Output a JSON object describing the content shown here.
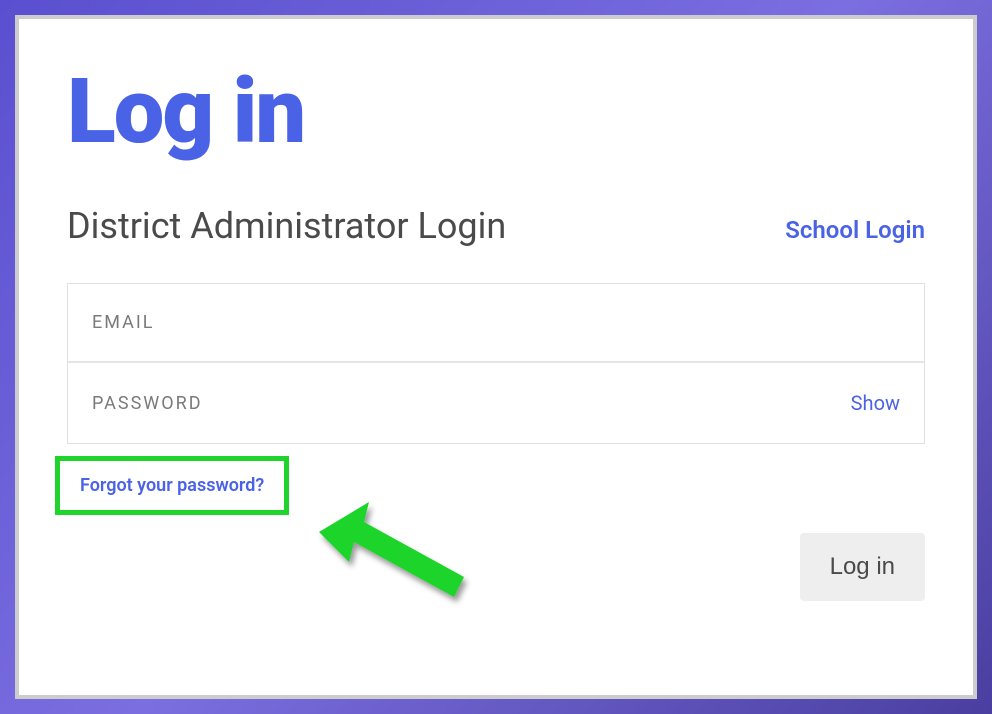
{
  "title": "Log in",
  "subtitle": "District Administrator Login",
  "alt_login_label": "School Login",
  "fields": {
    "email_label": "EMAIL",
    "password_label": "PASSWORD",
    "show_label": "Show"
  },
  "forgot_label": "Forgot your password?",
  "submit_label": "Log in",
  "annotation_color": "#1fd42b",
  "accent_color": "#4a63e6"
}
